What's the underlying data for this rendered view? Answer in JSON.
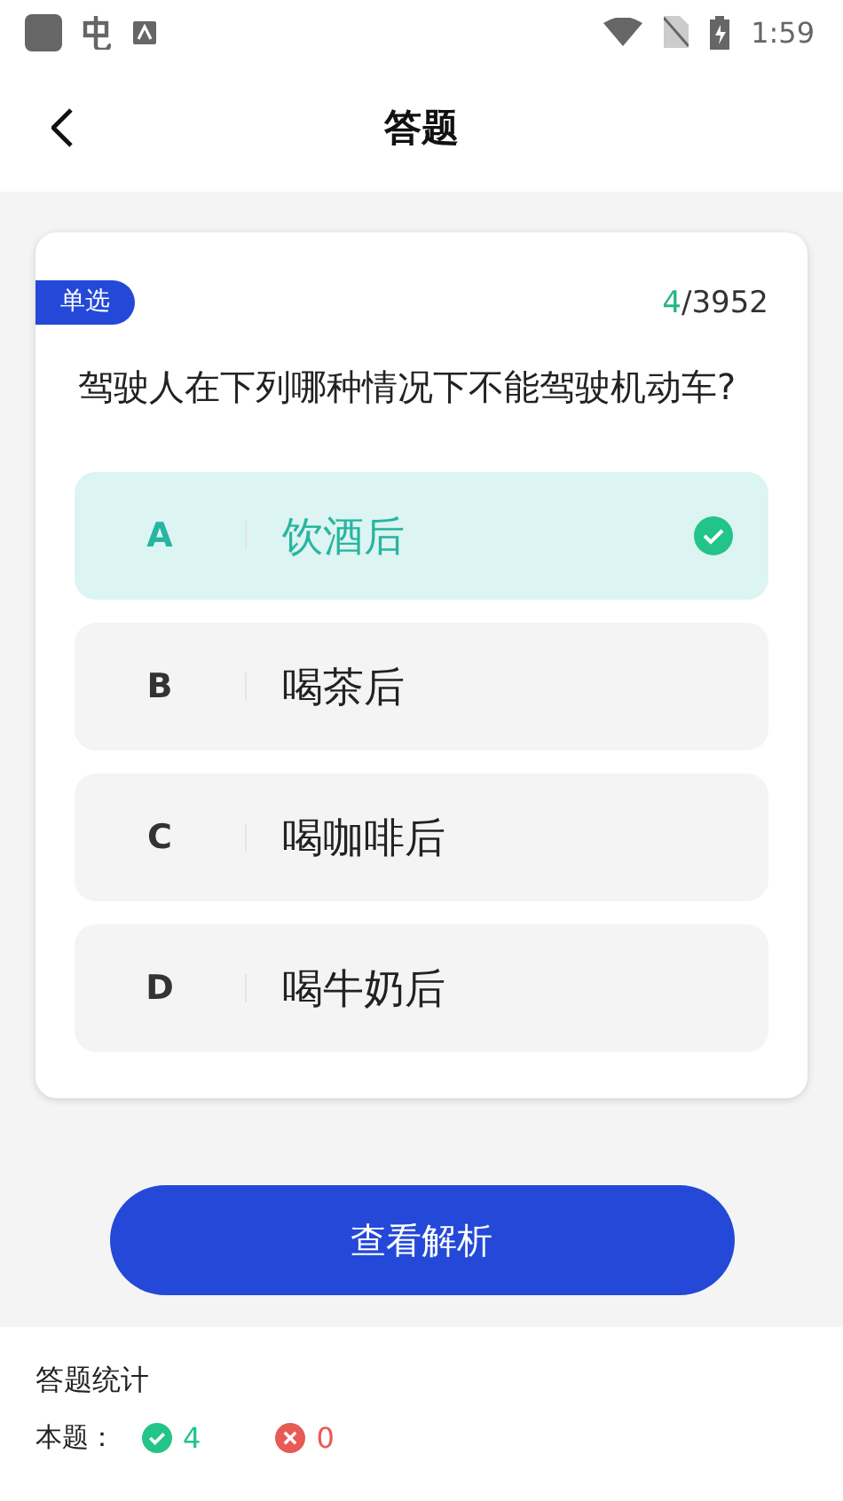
{
  "status_bar": {
    "time": "1:59"
  },
  "header": {
    "title": "答题"
  },
  "question": {
    "type_tag": "单选",
    "current": "4",
    "total": "/3952",
    "text": "驾驶人在下列哪种情况下不能驾驶机动车?"
  },
  "options": [
    {
      "letter": "A",
      "text": "饮酒后",
      "selected": true
    },
    {
      "letter": "B",
      "text": "喝茶后",
      "selected": false
    },
    {
      "letter": "C",
      "text": "喝咖啡后",
      "selected": false
    },
    {
      "letter": "D",
      "text": "喝牛奶后",
      "selected": false
    }
  ],
  "analysis_button": "查看解析",
  "stats": {
    "title": "答题统计",
    "label": "本题：",
    "correct": "4",
    "wrong": "0"
  }
}
